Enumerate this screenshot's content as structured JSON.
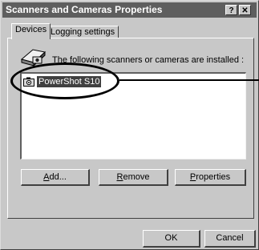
{
  "window": {
    "title": "Scanners and Cameras Properties",
    "help_label": "?",
    "close_label": "✕"
  },
  "tabs": [
    {
      "label": "Devices"
    },
    {
      "label": "Logging settings"
    }
  ],
  "devices": {
    "info_text": "The following scanners or cameras are installed :",
    "items": [
      {
        "label": "PowerShot S10",
        "selected": true
      }
    ],
    "buttons": {
      "add": {
        "mnemonic": "A",
        "rest": "dd..."
      },
      "remove": {
        "mnemonic": "R",
        "rest": "emove"
      },
      "properties": {
        "mnemonic": "P",
        "rest": "roperties"
      }
    }
  },
  "footer": {
    "ok_label": "OK",
    "cancel_label": "Cancel"
  },
  "colors": {
    "dialog_face": "#c8c8c8",
    "title_bar": "#5e5e5e",
    "selection": "#404040"
  }
}
